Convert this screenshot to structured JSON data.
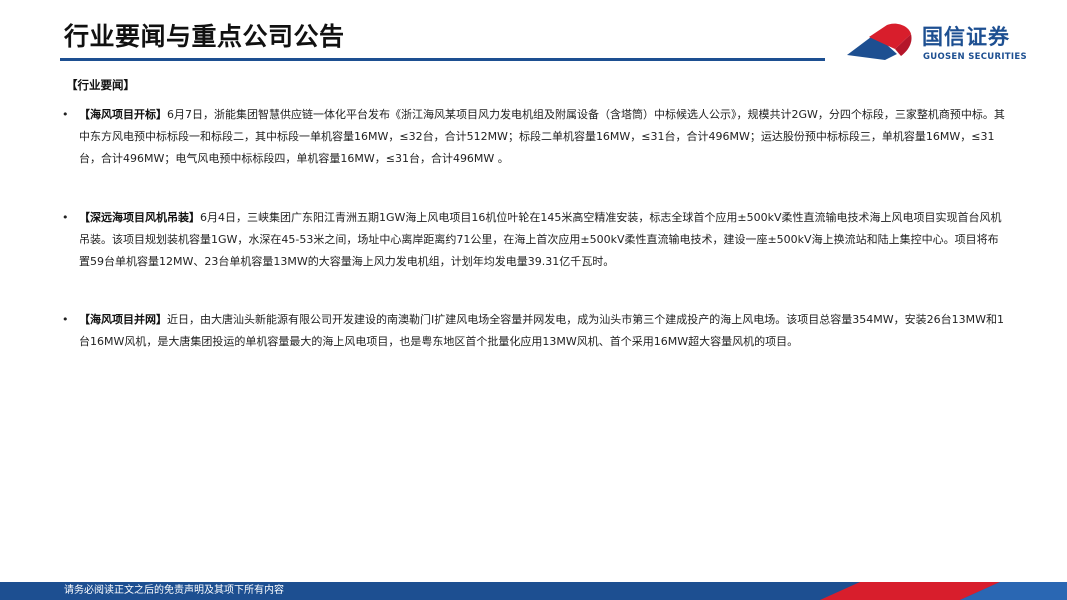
{
  "header": {
    "title": "行业要闻与重点公司公告"
  },
  "logo": {
    "cn_name": "国信证券",
    "en_name": "GUOSEN SECURITIES"
  },
  "section": {
    "label": "【行业要闻】"
  },
  "news": [
    {
      "bullet": "•",
      "tag": "【海风项目开标】",
      "text": "6月7日，浙能集团智慧供应链一体化平台发布《浙江海风某项目风力发电机组及附属设备（含塔筒）中标候选人公示》，规模共计2GW，分四个标段，三家整机商预中标。其中东方风电预中标标段一和标段二，其中标段一单机容量16MW，≤32台，合计512MW；标段二单机容量16MW，≤31台，合计496MW；运达股份预中标标段三，单机容量16MW，≤31台，合计496MW；电气风电预中标标段四，单机容量16MW，≤31台，合计496MW 。"
    },
    {
      "bullet": "•",
      "tag": "【深远海项目风机吊装】",
      "text": "6月4日，三峡集团广东阳江青洲五期1GW海上风电项目16机位叶轮在145米高空精准安装，标志全球首个应用±500kV柔性直流输电技术海上风电项目实现首台风机吊装。该项目规划装机容量1GW，水深在45-53米之间，场址中心离岸距离约71公里，在海上首次应用±500kV柔性直流输电技术，建设一座±500kV海上换流站和陆上集控中心。项目将布置59台单机容量12MW、23台单机容量13MW的大容量海上风力发电机组，计划年均发电量39.31亿千瓦时。"
    },
    {
      "bullet": "•",
      "tag": "【海风项目并网】",
      "text": "近日，由大唐汕头新能源有限公司开发建设的南澳勒门Ⅰ扩建风电场全容量并网发电，成为汕头市第三个建成投产的海上风电场。该项目总容量354MW，安装26台13MW和1台16MW风机，是大唐集团投运的单机容量最大的海上风电项目，也是粤东地区首个批量化应用13MW风机、首个采用16MW超大容量风机的项目。"
    }
  ],
  "footer": {
    "disclaimer": "请务必阅读正文之后的免责声明及其项下所有内容"
  },
  "colors": {
    "brand_blue": "#1d4f91",
    "brand_red": "#d81e2c",
    "text": "#222222"
  }
}
